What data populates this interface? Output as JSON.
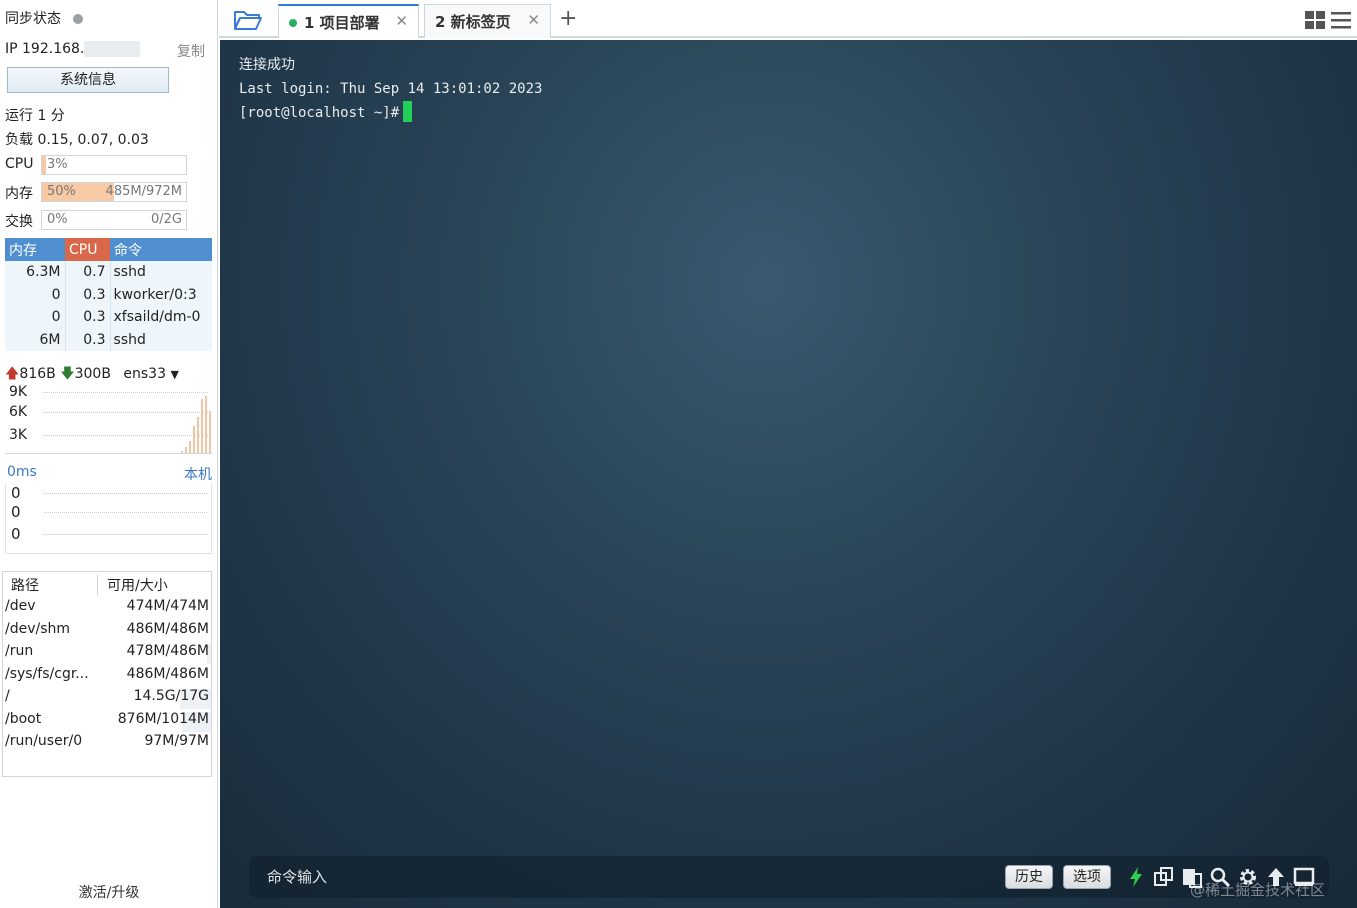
{
  "sidebar": {
    "sync_status": "同步状态",
    "ip_label": "IP 192.168.",
    "copy_label": "复制",
    "sysinfo_button": "系统信息",
    "uptime": "运行 1 分",
    "load": "负载 0.15, 0.07, 0.03",
    "cpu": {
      "label": "CPU",
      "value": "3%",
      "fraction": 0.03
    },
    "memory": {
      "label": "内存",
      "percent": "50%",
      "usage": "485M/972M",
      "fraction": 0.5
    },
    "swap": {
      "label": "交换",
      "percent": "0%",
      "usage": "0/2G",
      "fraction": 0.0
    },
    "process_table": {
      "headers": {
        "mem": "内存",
        "cpu": "CPU",
        "cmd": "命令"
      },
      "rows": [
        {
          "mem": "6.3M",
          "cpu": "0.7",
          "cmd": "sshd"
        },
        {
          "mem": "0",
          "cpu": "0.3",
          "cmd": "kworker/0:3"
        },
        {
          "mem": "0",
          "cpu": "0.3",
          "cmd": "xfsaild/dm-0"
        },
        {
          "mem": "6M",
          "cpu": "0.3",
          "cmd": "sshd"
        }
      ]
    },
    "network": {
      "upload": "816B",
      "download": "300B",
      "interface": "ens33",
      "y_labels": [
        "9K",
        "6K",
        "3K"
      ],
      "recent_traffic_k": [
        0.3,
        1.0,
        2.0,
        4.5,
        6.0,
        9.0,
        9.5,
        7.0
      ]
    },
    "latency": {
      "value": "0ms",
      "host": "本机",
      "y_labels": [
        "0",
        "0",
        "0"
      ]
    },
    "disk": {
      "headers": {
        "path": "路径",
        "size": "可用/大小"
      },
      "rows": [
        {
          "path": "/dev",
          "size": "474M/474M",
          "used_fraction": 0.0
        },
        {
          "path": "/dev/shm",
          "size": "486M/486M",
          "used_fraction": 0.0
        },
        {
          "path": "/run",
          "size": "478M/486M",
          "used_fraction": 0.02
        },
        {
          "path": "/sys/fs/cgr...",
          "size": "486M/486M",
          "used_fraction": 0.0
        },
        {
          "path": "/",
          "size": "14.5G/17G",
          "used_fraction": 0.15
        },
        {
          "path": "/boot",
          "size": "876M/1014M",
          "used_fraction": 0.14
        },
        {
          "path": "/run/user/0",
          "size": "97M/97M",
          "used_fraction": 0.0
        }
      ]
    },
    "activate_label": "激活/升级"
  },
  "tabs": [
    {
      "label": "1 项目部署",
      "active": true
    },
    {
      "label": "2 新标签页",
      "active": false
    }
  ],
  "terminal": {
    "lines": [
      "连接成功",
      "Last login: Thu Sep 14 13:01:02 2023"
    ],
    "prompt": "[root@localhost ~]#"
  },
  "command_bar": {
    "placeholder": "命令输入",
    "history_button": "历史",
    "options_button": "选项"
  },
  "watermark": "@稀土掘金技术社区",
  "colors": {
    "accent": "#2e7bd1",
    "cursor": "#22d058",
    "cpu_header": "#d9674a",
    "table_header": "#4f8fd0",
    "mem_fill": "#f7c9a4"
  }
}
